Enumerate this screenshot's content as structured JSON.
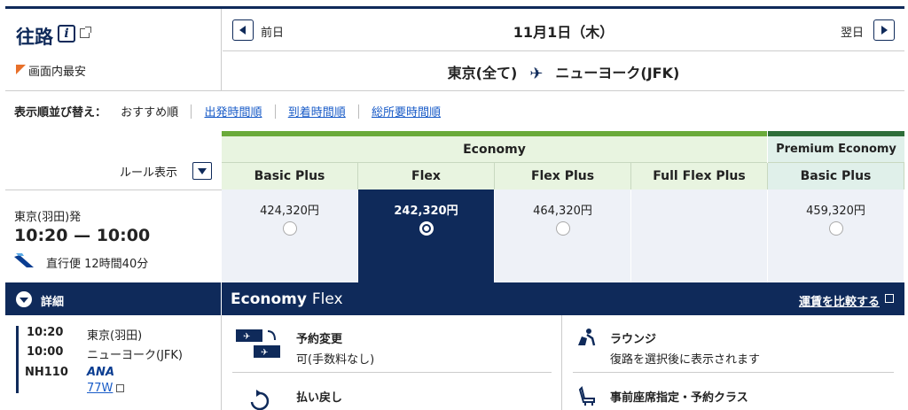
{
  "header": {
    "title": "往路",
    "cheapest_label": "画面内最安"
  },
  "date_nav": {
    "prev_label": "前日",
    "date": "11月1日（木）",
    "next_label": "翌日"
  },
  "route": {
    "origin": "東京(全て)",
    "destination": "ニューヨーク(JFK)"
  },
  "sort": {
    "label": "表示順並び替え：",
    "current": "おすすめ順",
    "options": [
      "出発時間順",
      "到着時間順",
      "総所要時間順"
    ]
  },
  "rule_toggle_label": "ルール表示",
  "cabins": {
    "economy": "Economy",
    "premium": "Premium Economy"
  },
  "fare_columns": [
    "Basic Plus",
    "Flex",
    "Flex Plus",
    "Full Flex Plus",
    "Basic Plus"
  ],
  "flight": {
    "departure": "東京(羽田)発",
    "times": "10:20 — 10:00",
    "type": "直行便 12時間40分"
  },
  "fares": [
    "424,320円",
    "242,320円",
    "464,320円",
    "",
    "459,320円"
  ],
  "selected_fare_index": 1,
  "detail": {
    "toggle_label": "詳細",
    "fare_name_bold": "Economy",
    "fare_name_rest": "Flex",
    "compare_link": "運賃を比較する"
  },
  "segment": {
    "dep_time": "10:20",
    "dep_city": "東京(羽田)",
    "arr_time": "10:00",
    "arr_city": "ニューヨーク(JFK)",
    "flight_no": "NH110",
    "airline": "ANA",
    "aircraft": "77W"
  },
  "conditions": [
    {
      "title": "予約変更",
      "value": "可(手数料なし)"
    },
    {
      "title": "ラウンジ",
      "value": "復路を選択後に表示されます"
    },
    {
      "title": "払い戻し",
      "value": ""
    },
    {
      "title": "事前座席指定・予約クラス",
      "value": ""
    }
  ],
  "colors": {
    "navy": "#0f2a5a",
    "economy_green": "#6aaa3a",
    "premium_green": "#2e6e3a",
    "cheapest_orange": "#e8702a",
    "link_blue": "#1a5cc8"
  }
}
